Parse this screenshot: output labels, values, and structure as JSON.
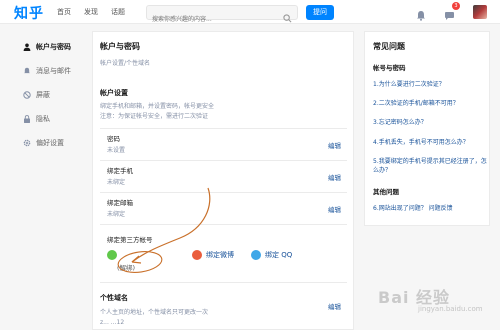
{
  "header": {
    "logo": "知乎",
    "nav": [
      "首页",
      "发现",
      "话题"
    ],
    "search_placeholder": "搜索你感兴趣的内容...",
    "ask_button": "提问",
    "notification_count": "3"
  },
  "sidebar": {
    "items": [
      {
        "label": "帐户与密码",
        "icon": "user-icon",
        "active": true
      },
      {
        "label": "消息与邮件",
        "icon": "bell-icon"
      },
      {
        "label": "屏蔽",
        "icon": "block-icon"
      },
      {
        "label": "隐私",
        "icon": "lock-icon"
      },
      {
        "label": "偏好设置",
        "icon": "gear-icon"
      }
    ]
  },
  "main": {
    "title": "帐户与密码",
    "subtitle": "帐户设置/个性域名",
    "section_title": "帐户设置",
    "section_desc_1": "绑定手机和邮箱，并设置密码，帐号更安全",
    "section_desc_2": "注意：为保证帐号安全，需进行二次验证",
    "rows": [
      {
        "label": "密码",
        "value": "未设置",
        "action": "编辑"
      },
      {
        "label": "绑定手机",
        "value": "未绑定",
        "action": "编辑"
      },
      {
        "label": "绑定邮箱",
        "value": "未绑定",
        "action": "编辑"
      }
    ],
    "third_party_label": "绑定第三方帐号",
    "third_party": [
      {
        "label": "",
        "color": "#60c84a"
      },
      {
        "label": "绑定微博",
        "color": "#ea5d3c"
      },
      {
        "label": "绑定 QQ",
        "color": "#3fa7e8"
      }
    ],
    "unbind": "(解绑)",
    "domain_title": "个性域名",
    "domain_desc": "个人主页的地址，个性域名只可更改一次",
    "domain_value": "z... ...12",
    "domain_action": "编辑"
  },
  "faq": {
    "title": "常见问题",
    "group1": "帐号与密码",
    "questions": [
      "1.为什么要进行二次验证？",
      "2.二次验证的手机/邮箱不可用？",
      "3.忘记密码怎么办？",
      "4.手机丢失，手机号不可用怎么办？",
      "5.我要绑定的手机号提示其已经注册了，怎么办？"
    ],
    "group2": "其他问题",
    "other_question": "6.网站出现了问题？",
    "feedback_link": "问题反馈"
  },
  "watermark": {
    "text": "Bai 经验",
    "sub": "jingyan.baidu.com"
  }
}
